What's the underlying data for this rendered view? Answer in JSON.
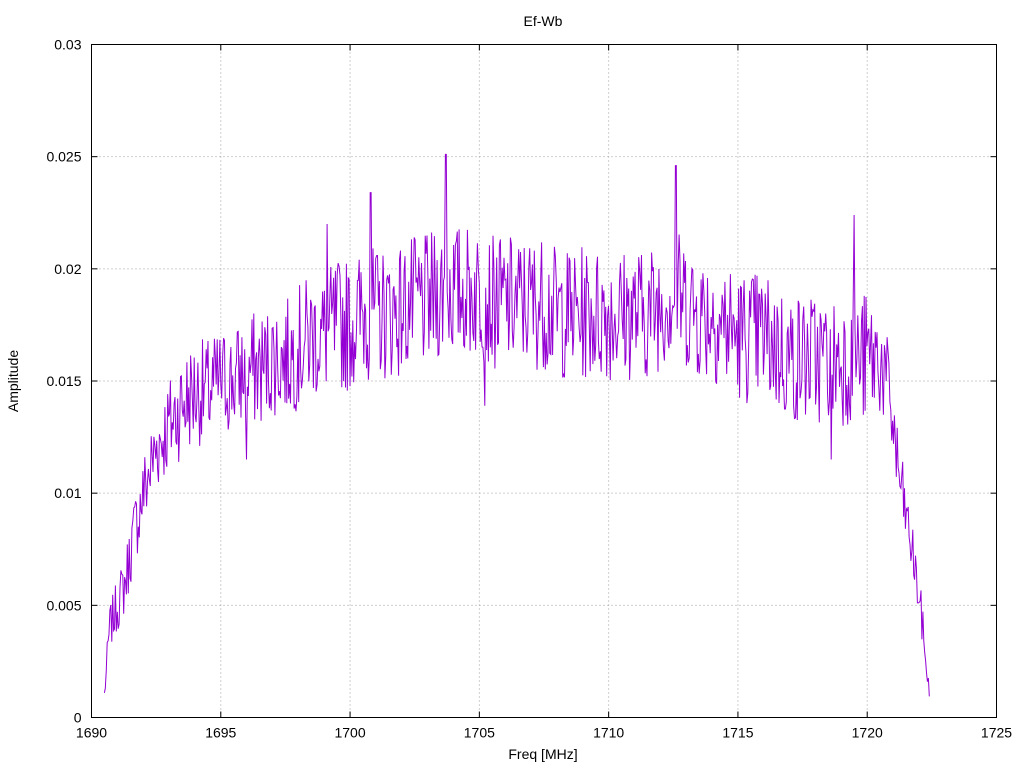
{
  "chart_data": {
    "type": "line",
    "title": "Ef-Wb",
    "xlabel": "Freq [MHz]",
    "ylabel": "Amplitude",
    "xlim": [
      1690,
      1725
    ],
    "ylim": [
      0,
      0.03
    ],
    "xticks": [
      "1690",
      "1695",
      "1700",
      "1705",
      "1710",
      "1715",
      "1720",
      "1725"
    ],
    "yticks": [
      "0",
      "0.005",
      "0.01",
      "0.015",
      "0.02",
      "0.025",
      "0.03"
    ],
    "grid": true,
    "legend": "none",
    "series": [
      {
        "color": "#9400d3",
        "noisy": true,
        "x": [
          1690.5,
          1690.7,
          1691.0,
          1691.3,
          1691.6,
          1692.0,
          1692.5,
          1693.0,
          1693.5,
          1694.0,
          1694.5,
          1695.0,
          1695.5,
          1696.0,
          1696.5,
          1697.0,
          1697.5,
          1698.0,
          1698.5,
          1699.0,
          1699.5,
          1700.0,
          1700.5,
          1701.0,
          1701.5,
          1702.0,
          1702.5,
          1703.0,
          1703.5,
          1704.0,
          1704.5,
          1705.0,
          1705.5,
          1706.0,
          1706.5,
          1707.0,
          1707.5,
          1708.0,
          1708.5,
          1709.0,
          1709.5,
          1710.0,
          1710.5,
          1711.0,
          1711.5,
          1712.0,
          1712.5,
          1713.0,
          1713.5,
          1714.0,
          1714.5,
          1715.0,
          1715.5,
          1716.0,
          1716.5,
          1717.0,
          1717.5,
          1718.0,
          1718.5,
          1719.0,
          1719.5,
          1720.0,
          1720.5,
          1720.9,
          1721.2,
          1721.5,
          1721.8,
          1722.1,
          1722.4
        ],
        "mean": [
          0.001,
          0.004,
          0.005,
          0.006,
          0.008,
          0.01,
          0.012,
          0.013,
          0.014,
          0.0145,
          0.0145,
          0.015,
          0.015,
          0.0155,
          0.0155,
          0.016,
          0.016,
          0.0165,
          0.017,
          0.017,
          0.0175,
          0.0175,
          0.018,
          0.018,
          0.018,
          0.0182,
          0.0185,
          0.0185,
          0.019,
          0.019,
          0.019,
          0.019,
          0.0185,
          0.0185,
          0.0185,
          0.0185,
          0.0185,
          0.018,
          0.018,
          0.018,
          0.018,
          0.018,
          0.018,
          0.018,
          0.018,
          0.0185,
          0.019,
          0.0185,
          0.018,
          0.018,
          0.0175,
          0.017,
          0.017,
          0.017,
          0.0165,
          0.016,
          0.016,
          0.016,
          0.016,
          0.016,
          0.016,
          0.016,
          0.016,
          0.014,
          0.011,
          0.009,
          0.007,
          0.0045,
          0.001
        ],
        "amplitude": [
          0.0005,
          0.001,
          0.0012,
          0.0014,
          0.0016,
          0.0018,
          0.002,
          0.0022,
          0.0024,
          0.0024,
          0.0024,
          0.0024,
          0.0024,
          0.0026,
          0.0026,
          0.0026,
          0.0026,
          0.0028,
          0.0028,
          0.0028,
          0.003,
          0.003,
          0.003,
          0.003,
          0.003,
          0.003,
          0.003,
          0.003,
          0.003,
          0.003,
          0.003,
          0.003,
          0.003,
          0.003,
          0.003,
          0.003,
          0.003,
          0.003,
          0.003,
          0.003,
          0.003,
          0.003,
          0.003,
          0.003,
          0.003,
          0.003,
          0.003,
          0.003,
          0.003,
          0.003,
          0.003,
          0.003,
          0.003,
          0.003,
          0.003,
          0.003,
          0.003,
          0.003,
          0.003,
          0.003,
          0.003,
          0.003,
          0.0026,
          0.0022,
          0.0018,
          0.0014,
          0.0012,
          0.001,
          0.0004
        ],
        "peaks": [
          {
            "x": 1703.7,
            "y": 0.0251
          },
          {
            "x": 1712.6,
            "y": 0.0246
          },
          {
            "x": 1700.8,
            "y": 0.0234
          },
          {
            "x": 1719.5,
            "y": 0.0224
          },
          {
            "x": 1699.1,
            "y": 0.022
          },
          {
            "x": 1718.6,
            "y": 0.0115
          },
          {
            "x": 1696.0,
            "y": 0.0115
          },
          {
            "x": 1705.2,
            "y": 0.0139
          }
        ]
      }
    ]
  }
}
